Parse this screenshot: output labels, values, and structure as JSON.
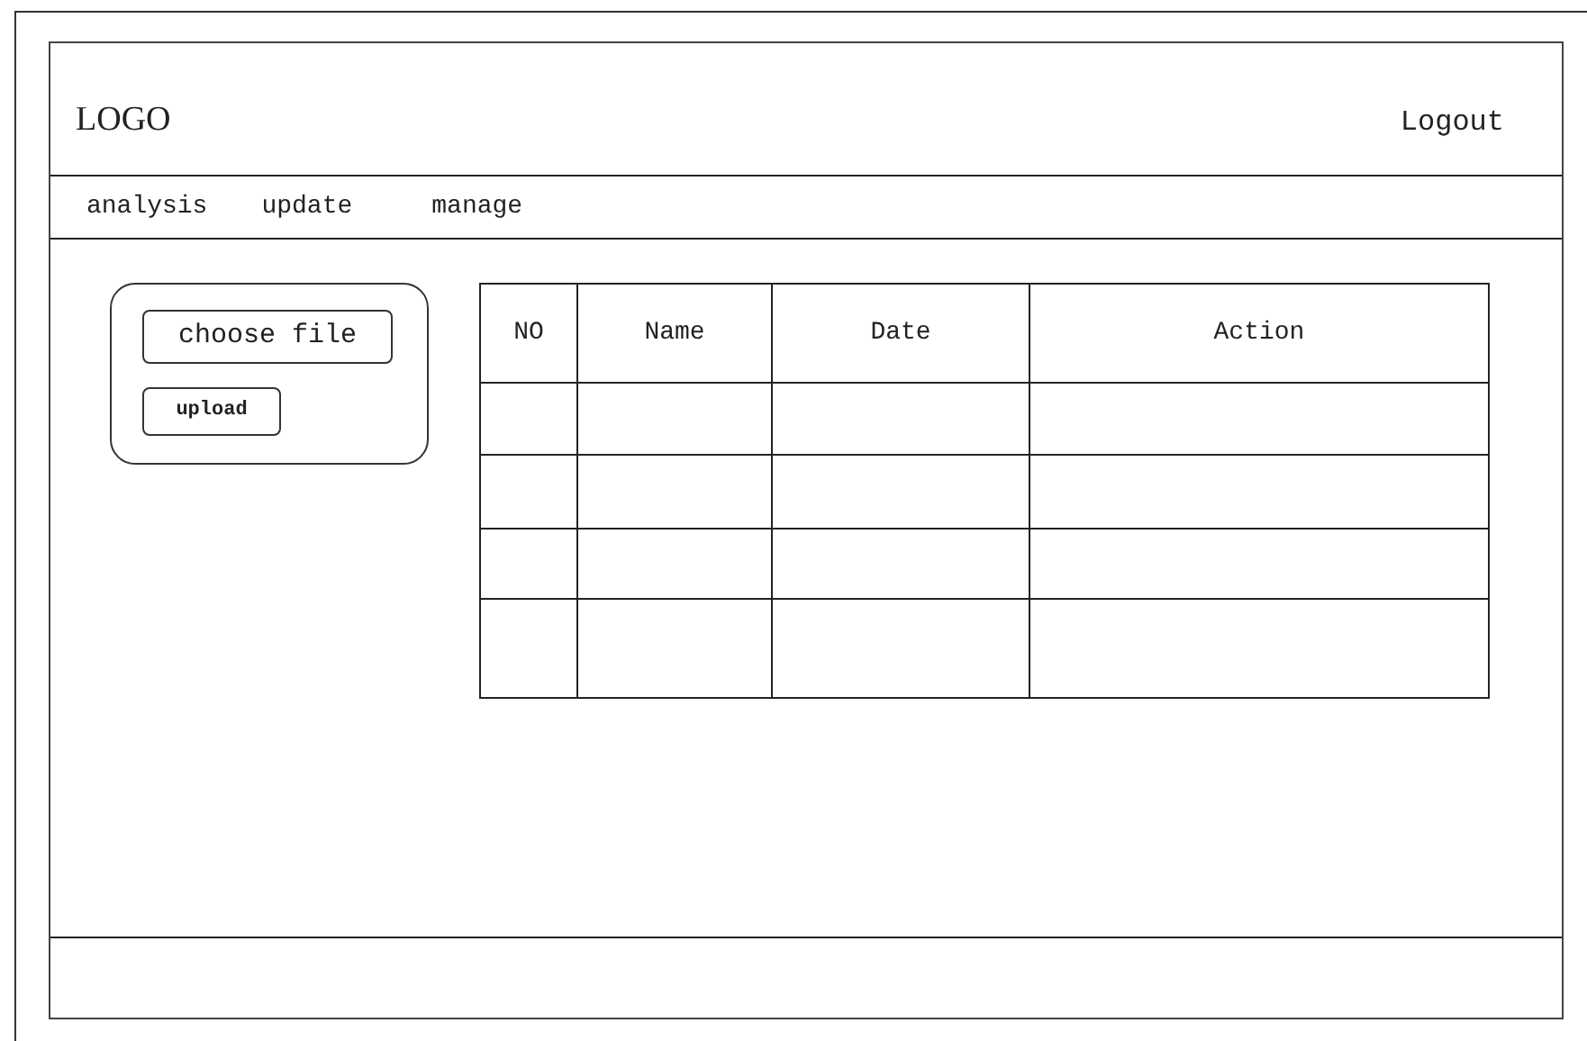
{
  "header": {
    "logo": "LOGO",
    "logout": "Logout"
  },
  "nav": [
    {
      "label": "analysis"
    },
    {
      "label": "update"
    },
    {
      "label": "manage"
    }
  ],
  "upload_panel": {
    "choose_button": "choose file",
    "upload_button": "upload"
  },
  "table": {
    "columns": [
      "NO",
      "Name",
      "Date",
      "Action"
    ]
  }
}
